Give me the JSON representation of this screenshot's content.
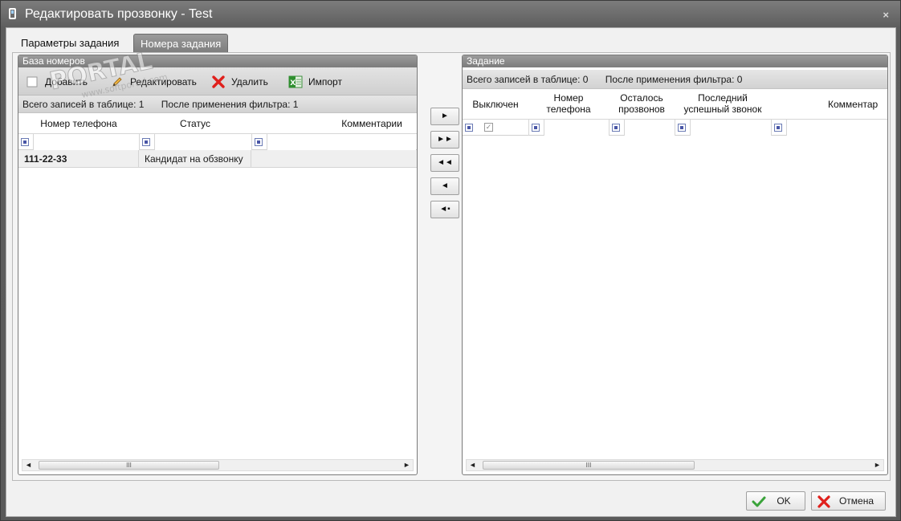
{
  "window": {
    "title": "Редактировать прозвонку - Test",
    "close_glyph": "×"
  },
  "tabs": [
    {
      "label": "Параметры задания",
      "active": false
    },
    {
      "label": "Номера задания",
      "active": true
    }
  ],
  "left_panel": {
    "title": "База номеров",
    "toolbar": {
      "add": "Добавить",
      "edit": "Редактировать",
      "delete": "Удалить",
      "import": "Импорт"
    },
    "status": {
      "total": "Всего записей в таблице: 1",
      "filtered": "После применения фильтра: 1"
    },
    "columns": [
      "Номер телефона",
      "Статус",
      "Комментарии"
    ],
    "rows": [
      {
        "phone": "111-22-33",
        "status": "Кандидат на обзвонку",
        "comment": ""
      }
    ]
  },
  "right_panel": {
    "title": "Задание",
    "status": {
      "total": "Всего записей в таблице: 0",
      "filtered": "После применения фильтра: 0"
    },
    "columns": [
      {
        "line1": "Выключен",
        "line2": ""
      },
      {
        "line1": "Номер",
        "line2": "телефона"
      },
      {
        "line1": "Осталось",
        "line2": "прозвонов"
      },
      {
        "line1": "Последний",
        "line2": "успешный звонок"
      },
      {
        "line1": "Комментар",
        "line2": ""
      }
    ]
  },
  "move_buttons": {
    "move_one_right": "►",
    "move_all_right": "►►",
    "move_all_left": "◄◄",
    "move_one_left": "◄",
    "remove_selected": "◄▪"
  },
  "scroll_thumb_label": "III",
  "buttons": {
    "ok": "OK",
    "cancel": "Отмена"
  },
  "watermark": {
    "text": "PORTAL",
    "url": "www.softportal.com"
  },
  "colors": {
    "accent_green": "#3aa33a",
    "delete_red": "#e0201c",
    "header_gray": "#8a8a8a"
  }
}
